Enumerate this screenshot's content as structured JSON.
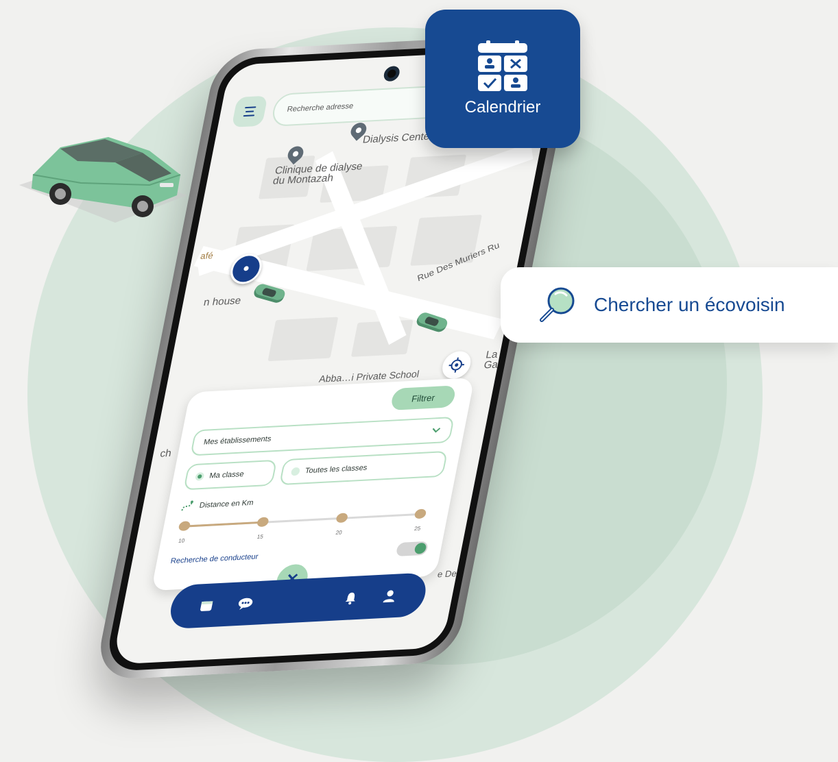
{
  "map": {
    "place_1": "Dialysis Center",
    "place_2": "Clinique de dialyse\ndu Montazah",
    "street_1": "Rue Des Muriers",
    "street_1_suffix": "Ru",
    "place_3": "Abba…i Private School",
    "place_4": "n house",
    "place_5": "afé",
    "place_6": "ch",
    "place_7": "La\nGa",
    "place_8": "e De"
  },
  "search": {
    "placeholder": "Recherche adresse"
  },
  "filter": {
    "button_label": "Filtrer",
    "select_value": "Mes établissements",
    "radio_1": "Ma classe",
    "radio_2": "Toutes les classes",
    "distance_label": "Distance en Km",
    "slider_ticks": [
      "10",
      "15",
      "20",
      "25"
    ],
    "slider_selected": [
      10,
      15
    ],
    "driver_search_label": "Recherche de conducteur",
    "driver_search_on": true
  },
  "bottom_nav": {
    "fab_symbol": "✕",
    "icons": [
      "calendar-icon",
      "chat-icon",
      "bell-icon",
      "user-icon"
    ]
  },
  "calendar_card": {
    "title": "Calendrier"
  },
  "search_card": {
    "label": "Chercher un écovoisin"
  },
  "colors": {
    "brand_blue": "#174a92",
    "mint": "#a7d8b6",
    "background_circle": "#d7e6dc"
  }
}
